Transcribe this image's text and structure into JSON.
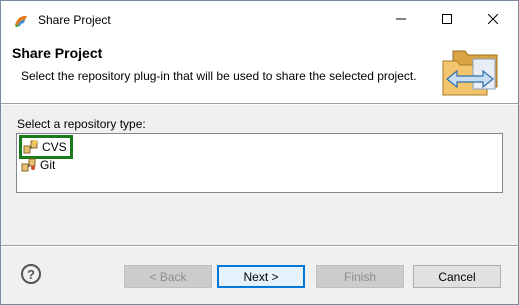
{
  "window": {
    "title": "Share Project",
    "icon": "eclipse-app-icon",
    "controls": {
      "minimize": "minimize-icon",
      "maximize": "maximize-icon",
      "close": "close-icon"
    }
  },
  "header": {
    "title": "Share Project",
    "description": "Select the repository plug-in that will be used to share the selected project.",
    "graphic": "share-project-banner-icon"
  },
  "body": {
    "type_label": "Select a repository type:",
    "repositories": [
      {
        "label": "CVS",
        "icon": "cvs-icon",
        "selected": true
      },
      {
        "label": "Git",
        "icon": "git-icon",
        "selected": false
      }
    ]
  },
  "footer": {
    "help_icon": "help-icon",
    "back_label": "< Back",
    "next_label": "Next >",
    "finish_label": "Finish",
    "cancel_label": "Cancel"
  },
  "colors": {
    "selection_highlight": "#1a7a1a",
    "default_button_border": "#0078d7"
  }
}
